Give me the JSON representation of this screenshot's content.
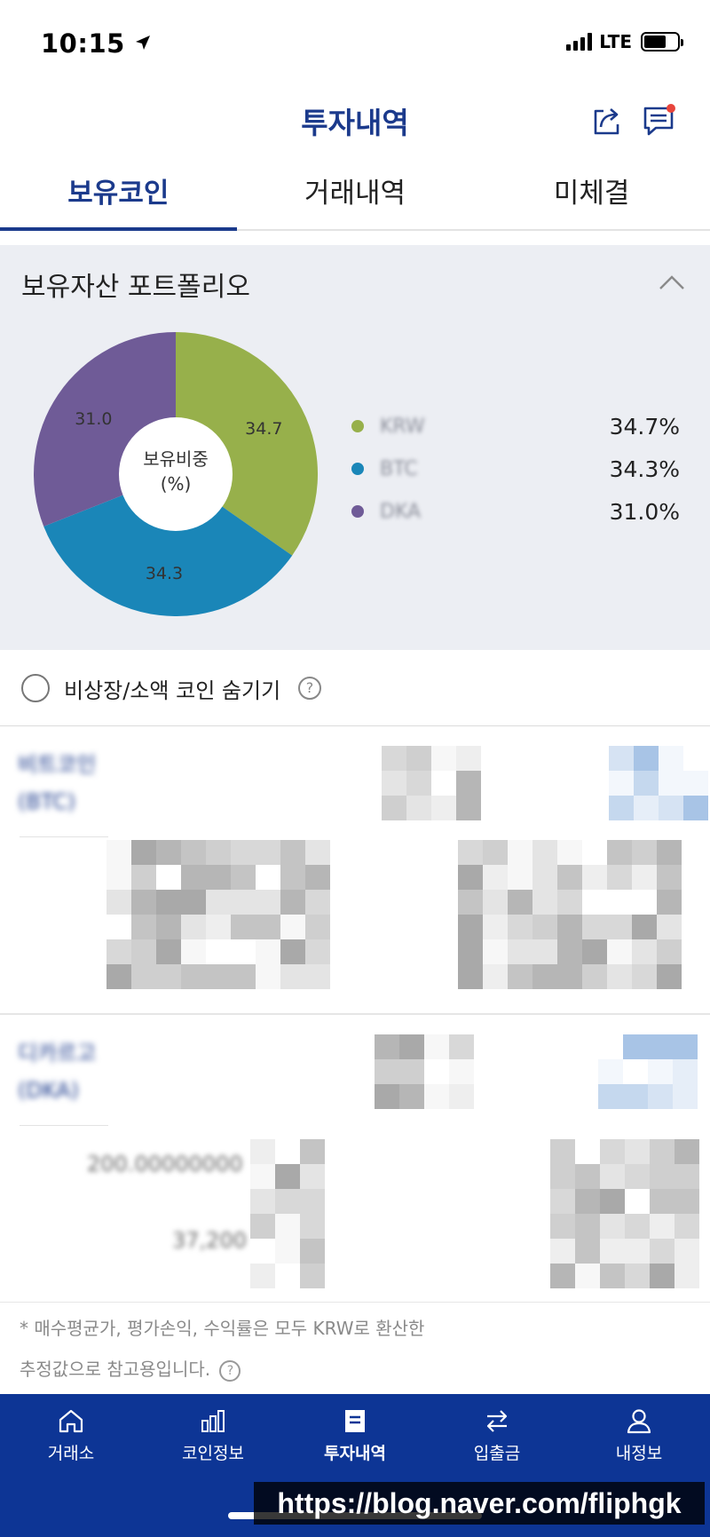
{
  "status_bar": {
    "time": "10:15",
    "network": "LTE"
  },
  "header": {
    "title": "투자내역",
    "share_icon": "share-icon",
    "chat_icon": "chat-icon"
  },
  "tabs": [
    {
      "label": "보유코인",
      "active": true
    },
    {
      "label": "거래내역",
      "active": false
    },
    {
      "label": "미체결",
      "active": false
    }
  ],
  "portfolio": {
    "title": "보유자산 포트폴리오",
    "center_label_1": "보유비중",
    "center_label_2": "(%)",
    "colors": {
      "krw": "#97b04b",
      "btc": "#1a86b8",
      "dka": "#6f5b97"
    }
  },
  "chart_data": {
    "type": "pie",
    "slices": [
      {
        "name": "KRW",
        "value": 34.7,
        "label": "34.7",
        "legend_pct": "34.7%",
        "color": "#97b04b"
      },
      {
        "name": "BTC",
        "value": 34.3,
        "label": "34.3",
        "legend_pct": "34.3%",
        "color": "#1a86b8"
      },
      {
        "name": "DKA",
        "value": 31.0,
        "label": "31.0",
        "legend_pct": "31.0%",
        "color": "#6f5b97"
      }
    ]
  },
  "hide_option": {
    "label": "비상장/소액 코인 숨기기",
    "help": "?"
  },
  "coins": [
    {
      "name_line1": "비트코인",
      "name_line2": "(BTC)"
    },
    {
      "name_line1": "디카르고",
      "name_line2": "(DKA)",
      "amount": "200.00000000",
      "price": "37,200"
    }
  ],
  "footnote": {
    "line1": "* 매수평균가, 평가손익, 수익률은 모두 KRW로 환산한",
    "line2": "추정값으로 참고용입니다.",
    "help": "?"
  },
  "bottom_nav": [
    {
      "label": "거래소",
      "icon": "home-icon"
    },
    {
      "label": "코인정보",
      "icon": "bar-chart-icon"
    },
    {
      "label": "투자내역",
      "icon": "document-icon",
      "active": true
    },
    {
      "label": "입출금",
      "icon": "transfer-icon"
    },
    {
      "label": "내정보",
      "icon": "user-icon"
    }
  ],
  "watermark": "https://blog.naver.com/fliphgk"
}
